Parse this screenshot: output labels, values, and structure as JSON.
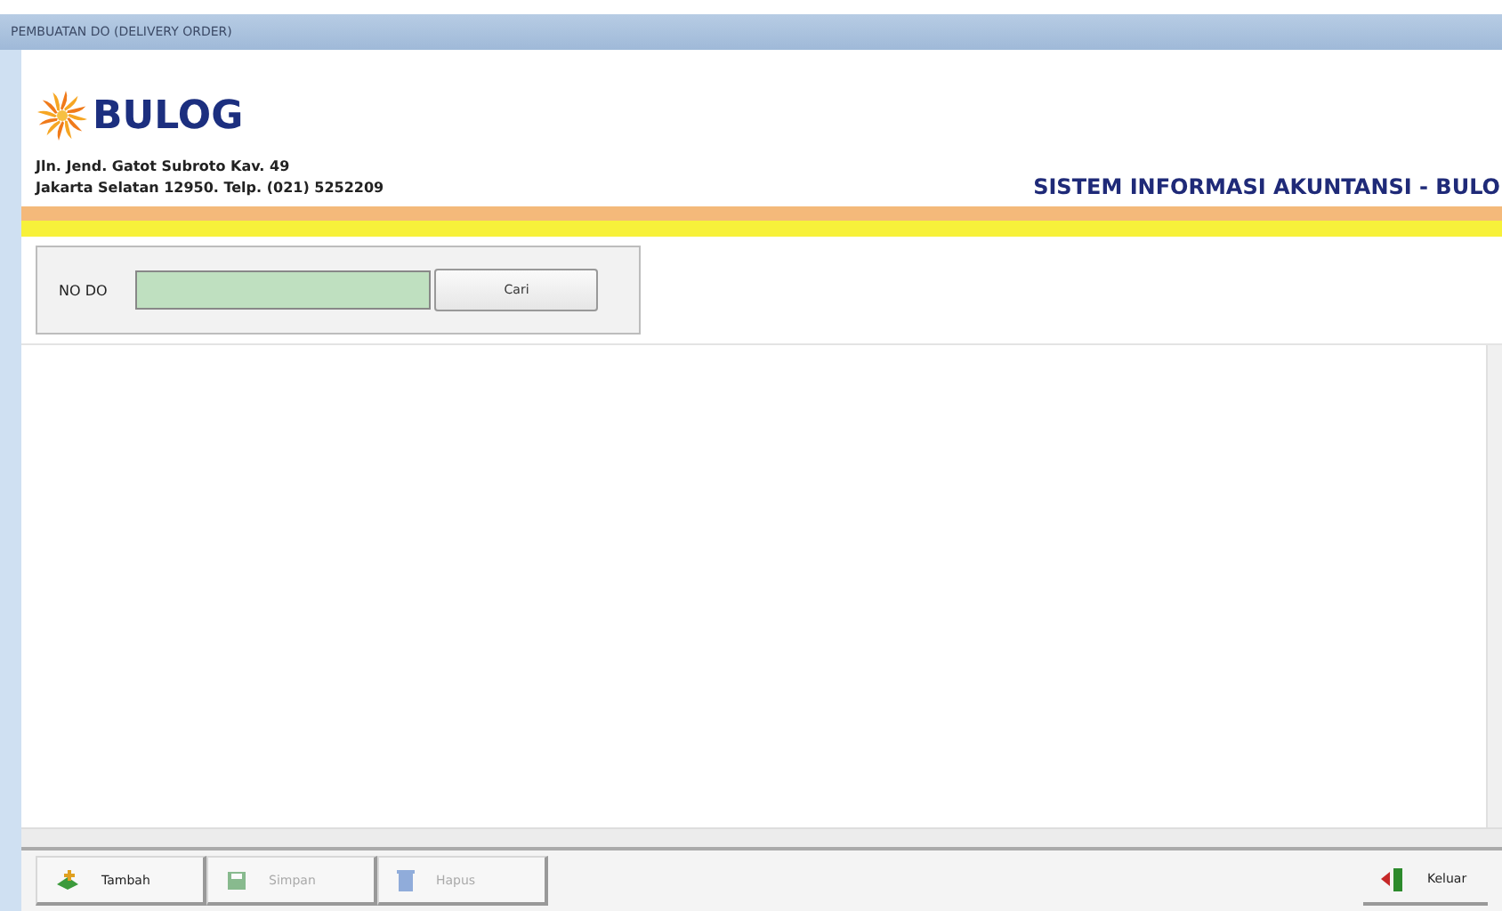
{
  "window": {
    "title": "PEMBUATAN DO (DELIVERY ORDER)"
  },
  "header": {
    "logo_text": "BULOG",
    "address_lines": [
      "Jln. Jend. Gatot Subroto Kav. 49",
      "Jakarta Selatan 12950. Telp. (021) 5252209"
    ],
    "system_title": "SISTEM INFORMASI AKUNTANSI - BULO"
  },
  "search": {
    "label": "NO DO",
    "button": "Cari"
  },
  "toolbar": {
    "buttons": [
      {
        "label": "Tambah",
        "kind": "add",
        "disabled": false
      },
      {
        "label": "Simpan",
        "kind": "save",
        "disabled": true
      },
      {
        "label": "Hapus",
        "kind": "delete",
        "disabled": true
      }
    ],
    "exit": {
      "label": "Keluar",
      "kind": "exit",
      "disabled": false
    }
  }
}
